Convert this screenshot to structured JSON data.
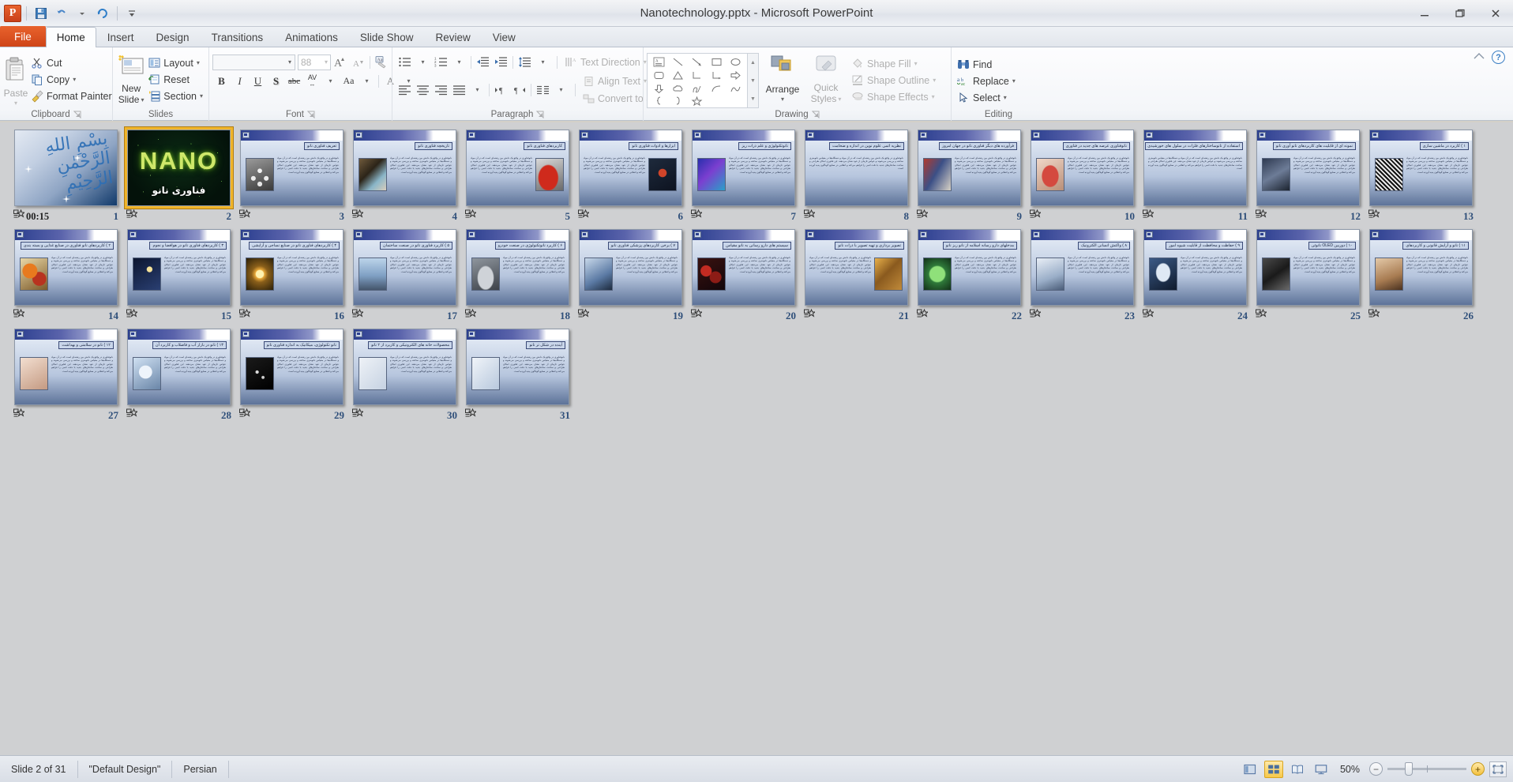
{
  "window": {
    "title": "Nanotechnology.pptx  -  Microsoft PowerPoint",
    "app_logo": "powerpoint-logo",
    "minimize": "minimize",
    "restore": "restore",
    "close": "close"
  },
  "quick_access": {
    "save": "save-icon",
    "undo": "undo-icon",
    "redo": "redo-icon",
    "customize": "customize-qat-icon"
  },
  "tabs": [
    {
      "label": "File",
      "active": false,
      "file": true
    },
    {
      "label": "Home",
      "active": true
    },
    {
      "label": "Insert",
      "active": false
    },
    {
      "label": "Design",
      "active": false
    },
    {
      "label": "Transitions",
      "active": false
    },
    {
      "label": "Animations",
      "active": false
    },
    {
      "label": "Slide Show",
      "active": false
    },
    {
      "label": "Review",
      "active": false
    },
    {
      "label": "View",
      "active": false
    }
  ],
  "ribbon": {
    "clipboard": {
      "label": "Clipboard",
      "paste": "Paste",
      "cut": "Cut",
      "copy": "Copy",
      "format_painter": "Format Painter"
    },
    "slides": {
      "label": "Slides",
      "new_slide": "New\nSlide",
      "new_slide_line1": "New",
      "new_slide_line2": "Slide",
      "layout": "Layout",
      "reset": "Reset",
      "section": "Section"
    },
    "font": {
      "label": "Font",
      "font_name": "",
      "font_name_placeholder": "",
      "font_size": "88",
      "grow_font": "grow-font-icon",
      "shrink_font": "shrink-font-icon",
      "clear_formatting": "clear-formatting-icon",
      "bold": "B",
      "italic": "I",
      "underline": "U",
      "shadow": "S",
      "strikethrough": "abc",
      "character_spacing": "AV",
      "change_case": "Aa",
      "font_color": "A"
    },
    "paragraph": {
      "label": "Paragraph",
      "bullets": "bullets-icon",
      "numbering": "numbering-icon",
      "decrease_indent": "decrease-indent-icon",
      "increase_indent": "increase-indent-icon",
      "line_spacing": "line-spacing-icon",
      "align_left": "align-left-icon",
      "align_center": "align-center-icon",
      "align_right": "align-right-icon",
      "justify": "justify-icon",
      "ltr": "left-to-right-icon",
      "rtl": "right-to-left-icon",
      "columns": "columns-icon",
      "text_direction": "Text Direction",
      "align_text": "Align Text",
      "convert_to_smartart": "Convert to SmartArt"
    },
    "drawing": {
      "label": "Drawing",
      "arrange": "Arrange",
      "quick_styles_line1": "Quick",
      "quick_styles_line2": "Styles",
      "shape_fill": "Shape Fill",
      "shape_outline": "Shape Outline",
      "shape_effects": "Shape Effects",
      "shapes": [
        "textbox",
        "line",
        "arrow",
        "rectangle",
        "oval",
        "rounded-rectangle",
        "triangle",
        "elbow-connector",
        "elbow-arrow-connector",
        "block-arrow-right",
        "block-arrow-down",
        "cloud-callout",
        "freeform",
        "arc",
        "curve",
        "left-brace",
        "right-brace",
        "star"
      ]
    },
    "editing": {
      "label": "Editing",
      "find": "Find",
      "replace": "Replace",
      "select": "Select"
    }
  },
  "status_bar": {
    "slide_indicator": "Slide 2 of 31",
    "theme": "\"Default Design\"",
    "language": "Persian",
    "zoom_level": "50%",
    "views": [
      {
        "name": "normal-view",
        "active": false
      },
      {
        "name": "slide-sorter-view",
        "active": true
      },
      {
        "name": "reading-view",
        "active": false
      },
      {
        "name": "slide-show-view",
        "active": false
      }
    ],
    "fit_to_window": "fit-slide-to-window-icon"
  },
  "slides": [
    {
      "n": "1",
      "kind": "bismillah",
      "timing": "00:15",
      "selected": false,
      "title": "",
      "has_anim": true
    },
    {
      "n": "2",
      "kind": "nano",
      "selected": true,
      "has_anim": true,
      "nano_word": "NANO",
      "nano_fa": "فناوری نانو"
    },
    {
      "n": "3",
      "kind": "content",
      "has_anim": true,
      "title": "تعریف فناوری نانو",
      "img": "molecule",
      "img_side": "left"
    },
    {
      "n": "4",
      "kind": "content",
      "has_anim": true,
      "title": "تاریخچه فناوری نانو",
      "img": "collage",
      "img_side": "left"
    },
    {
      "n": "5",
      "kind": "content",
      "has_anim": true,
      "title": "کاربردهای فناوری نانو",
      "img": "car-red",
      "img_side": "right"
    },
    {
      "n": "6",
      "kind": "content",
      "has_anim": true,
      "title": "ابزارها و ادوات فناوری نانو",
      "img": "spider",
      "img_side": "right"
    },
    {
      "n": "7",
      "kind": "content",
      "has_anim": true,
      "title": "نانوتکنولوژی و علم ذرات ریز",
      "img": "crystal",
      "img_side": "left"
    },
    {
      "n": "8",
      "kind": "content",
      "has_anim": true,
      "title": "نظریه اتمی علوم نوین در اندازه و ضخامت",
      "img": "",
      "img_side": "none"
    },
    {
      "n": "9",
      "kind": "content",
      "has_anim": true,
      "title": "فرآورده های دیگر فناوری نانو در جهان امروز",
      "img": "lab-collage",
      "img_side": "left"
    },
    {
      "n": "10",
      "kind": "content",
      "has_anim": true,
      "title": "نانوفناوری عرصه های جدید در فناوری",
      "img": "lips",
      "img_side": "left"
    },
    {
      "n": "11",
      "kind": "content",
      "has_anim": true,
      "title": "استفاده از نانوساختارهای فلزات در سلول های خورشیدی",
      "img": "",
      "img_side": "none"
    },
    {
      "n": "12",
      "kind": "content",
      "has_anim": true,
      "title": "نمونه ای از قابلیت های کاربردهای نانو آوری نانو",
      "img": "micro",
      "img_side": "left"
    },
    {
      "n": "13",
      "kind": "content",
      "has_anim": true,
      "title": "۱ ) کاربرد در ماشین سازی",
      "img": "bw-texture",
      "img_side": "left"
    },
    {
      "n": "14",
      "kind": "content",
      "has_anim": true,
      "title": "۲ ) کاربردهای نانو فناوری در صنایع غذایی و بسته بندی",
      "img": "fruit",
      "img_side": "left"
    },
    {
      "n": "15",
      "kind": "content",
      "has_anim": true,
      "title": "۳ ) کاربردهای فناوری نانو در هوافضا و نجوم",
      "img": "space",
      "img_side": "left"
    },
    {
      "n": "16",
      "kind": "content",
      "has_anim": true,
      "title": "۴ ) کاربردهای فناوری نانو در صنایع نساجی و آرایشی",
      "img": "sun-burst",
      "img_side": "left"
    },
    {
      "n": "17",
      "kind": "content",
      "has_anim": true,
      "title": "۵ ) کاربرد فناوری نانو در صنعت ساختمان",
      "img": "building",
      "img_side": "left"
    },
    {
      "n": "18",
      "kind": "content",
      "has_anim": true,
      "title": "۶ ) کاربرد نانوتکنولوژی در صنعت خودرو",
      "img": "car-gray",
      "img_side": "left"
    },
    {
      "n": "19",
      "kind": "content",
      "has_anim": true,
      "title": "۷ ) برخی کاربردهای پزشکی فناوری نانو",
      "img": "stethoscope",
      "img_side": "left"
    },
    {
      "n": "20",
      "kind": "content",
      "has_anim": true,
      "title": "سیستم های دارو رسانی به نانو مقیاس",
      "img": "red-cells",
      "img_side": "left"
    },
    {
      "n": "21",
      "kind": "content",
      "has_anim": true,
      "title": "تصویر برداری و تهیه تصویر با ذرات نانو",
      "img": "crystals",
      "img_side": "right"
    },
    {
      "n": "22",
      "kind": "content",
      "has_anim": true,
      "title": "مدخلهای دارو رسانه اسلامه از نانو ریز نانو",
      "img": "green-globe",
      "img_side": "left"
    },
    {
      "n": "23",
      "kind": "content",
      "has_anim": true,
      "title": "۸ ) واکنش انسانی الکترونیک",
      "img": "person",
      "img_side": "left"
    },
    {
      "n": "24",
      "kind": "content",
      "has_anim": true,
      "title": "۹ ) حفاظت و محافظت از قابلیت شیوه امور",
      "img": "face",
      "img_side": "left"
    },
    {
      "n": "25",
      "kind": "content",
      "has_anim": true,
      "title": "۱۰ ) دوربین OLED نانوئی",
      "img": "chip",
      "img_side": "left"
    },
    {
      "n": "26",
      "kind": "content",
      "has_anim": true,
      "title": "۱۱ ) نانو و آرایش قانونی و کاربردهای",
      "img": "portrait",
      "img_side": "left"
    },
    {
      "n": "27",
      "kind": "content",
      "has_anim": true,
      "title": "۱۲ ) نانو در سلامتی و بهداشت",
      "img": "skin",
      "img_side": "left"
    },
    {
      "n": "28",
      "kind": "content",
      "has_anim": true,
      "title": "۱۳ ) نانو در بازار آب و فاضلاب و کاربرد آن",
      "img": "magnifier",
      "img_side": "left"
    },
    {
      "n": "29",
      "kind": "content",
      "has_anim": true,
      "title": "نانو تکنولوژی، میکانیک به اندازه فناوری نانو",
      "img": "dark-cells",
      "img_side": "left"
    },
    {
      "n": "30",
      "kind": "content",
      "has_anim": true,
      "title": "محصولات خانه های الکترونیکی و کاربرد از ۲ نانو",
      "img": "icons-grid",
      "img_side": "left"
    },
    {
      "n": "31",
      "kind": "content",
      "has_anim": true,
      "title": "آینده در شکل تر نانو",
      "img": "future-icons",
      "img_side": "left"
    }
  ],
  "lorem_fa": "نانوفناوری در واقع یک دانش بین رشته‌ای است که در آن مواد و دستگاه‌ها در مقیاس نانومتری ساخته و بررسی می‌شوند و خواص تازه‌ای از خود نشان می‌دهند. این فناوری امکان طراحی و ساخت ساختارهای جدید با دقت اتمی را فراهم می‌کند و انقلابی در صنایع گوناگون پدید آورده است."
}
